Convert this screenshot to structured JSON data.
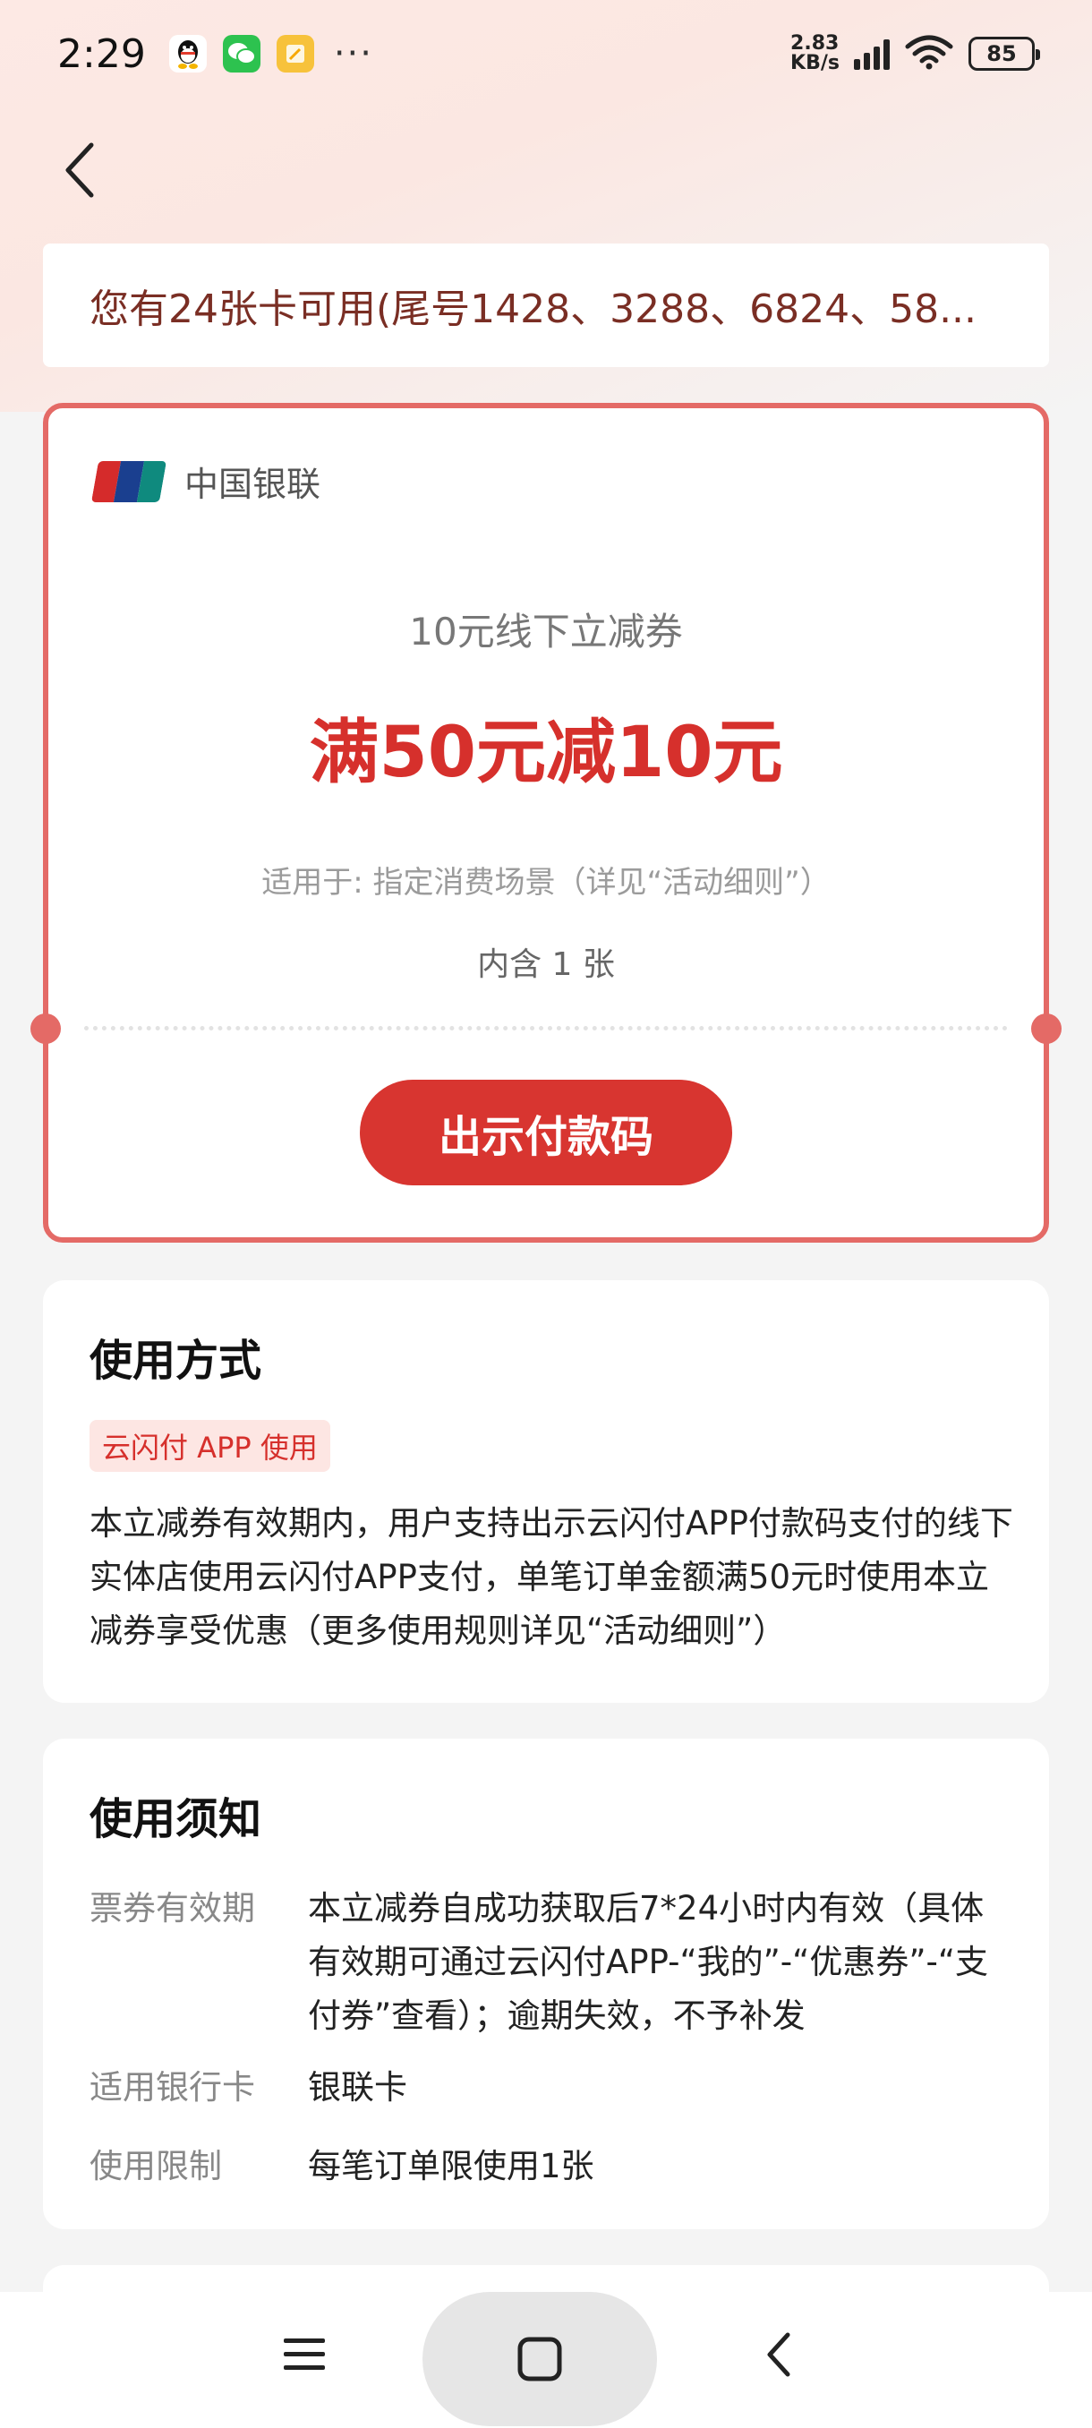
{
  "status_bar": {
    "time": "2:29",
    "notification_icons": [
      "qq-icon",
      "wechat-icon",
      "notes-icon"
    ],
    "more": "···",
    "net_speed_value": "2.83",
    "net_speed_unit": "KB/s",
    "battery": "85"
  },
  "header": {
    "back_icon": "chevron-left-icon"
  },
  "cards_banner": {
    "text": "您有24张卡可用(尾号1428、3288、6824、58..."
  },
  "coupon": {
    "brand": "中国银联",
    "name": "10元线下立减券",
    "amount": "满50元减10元",
    "scope": "适用于: 指定消费场景（详见“活动细则”）",
    "count": "内含 1 张",
    "pay_button": "出示付款码"
  },
  "usage_method": {
    "title": "使用方式",
    "tag": "云闪付 APP 使用",
    "description": "本立减券有效期内，用户支持出示云闪付APP付款码支付的线下实体店使用云闪付APP支付，单笔订单金额满50元时使用本立减券享受优惠（更多使用规则详见“活动细则”）"
  },
  "usage_notice": {
    "title": "使用须知",
    "rows": [
      {
        "label": "票券有效期",
        "value": "本立减券自成功获取后7*24小时内有效（具体有效期可通过云闪付APP-“我的”-“优惠券”-“支付券”查看）；逾期失效，不予补发"
      },
      {
        "label": "适用银行卡",
        "value": "银联卡"
      },
      {
        "label": "使用限制",
        "value": "每笔订单限使用1张"
      }
    ]
  },
  "nav_bar": {
    "icons": [
      "menu-icon",
      "home-icon",
      "back-icon"
    ]
  },
  "colors": {
    "accent_red": "#d6302c",
    "card_border": "#e46a66",
    "banner_text": "#7a2e24"
  }
}
